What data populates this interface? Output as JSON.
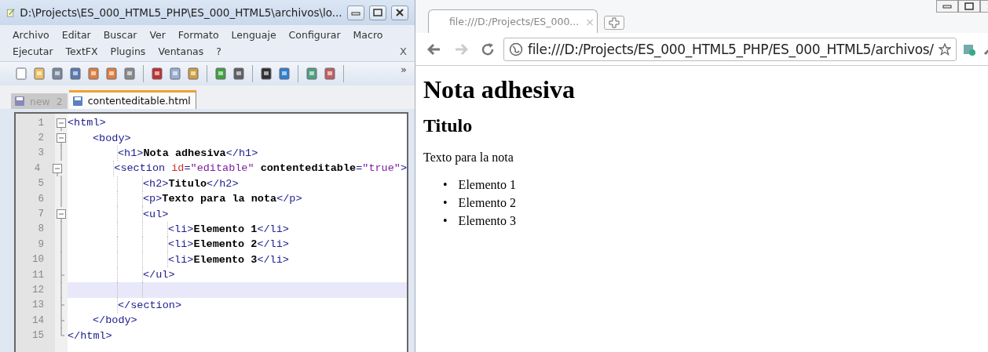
{
  "editor": {
    "title": "D:\\Projects\\ES_000_HTML5_PHP\\ES_000_HTML5\\archivos\\lo...",
    "menu_rows": [
      [
        "Archivo",
        "Editar",
        "Buscar",
        "Ver",
        "Formato",
        "Lenguaje",
        "Configurar",
        "Macro"
      ],
      [
        "Ejecutar",
        "TextFX",
        "Plugins",
        "Ventanas",
        "?"
      ]
    ],
    "menu_close": "X",
    "toolbar_more": "»",
    "tabs": [
      {
        "label": "new  2",
        "selected": false
      },
      {
        "label": "contenteditable.html",
        "selected": true
      }
    ],
    "lines": [
      {
        "number": "1",
        "kind": "fold-start",
        "current": false,
        "tokens": [
          {
            "kind": "tag",
            "text": "<html>"
          }
        ],
        "children": [
          {
            "number": "2",
            "kind": "fold-start",
            "current": false,
            "tokens": [
              {
                "kind": "tag",
                "text": "<body>"
              }
            ],
            "children": [
              {
                "number": "3",
                "kind": "fold-line",
                "current": false,
                "tokens": [
                  {
                    "kind": "tag",
                    "text": "<h1>"
                  },
                  {
                    "kind": "text",
                    "text": "Nota adhesiva"
                  },
                  {
                    "kind": "tag",
                    "text": "</h1>"
                  }
                ]
              },
              {
                "number": "4",
                "kind": "fold-start",
                "current": false,
                "tokens": [
                  {
                    "kind": "tag",
                    "text": "<section "
                  },
                  {
                    "kind": "attr",
                    "text": "id"
                  },
                  {
                    "kind": "tag",
                    "text": "="
                  },
                  {
                    "kind": "value",
                    "text": "\"editable\""
                  },
                  {
                    "kind": "text",
                    "text": " contenteditable"
                  },
                  {
                    "kind": "tag",
                    "text": "="
                  },
                  {
                    "kind": "value",
                    "text": "\"true\""
                  },
                  {
                    "kind": "tag",
                    "text": ">"
                  }
                ],
                "children": [
                  {
                    "number": "5",
                    "kind": "fold-line",
                    "current": false,
                    "tokens": [
                      {
                        "kind": "tag",
                        "text": "<h2>"
                      },
                      {
                        "kind": "text",
                        "text": "Titulo"
                      },
                      {
                        "kind": "tag",
                        "text": "</h2>"
                      }
                    ]
                  },
                  {
                    "number": "6",
                    "kind": "fold-line",
                    "current": false,
                    "tokens": [
                      {
                        "kind": "tag",
                        "text": "<p>"
                      },
                      {
                        "kind": "text",
                        "text": "Texto para la nota"
                      },
                      {
                        "kind": "tag",
                        "text": "</p>"
                      }
                    ]
                  },
                  {
                    "number": "7",
                    "kind": "fold-start",
                    "current": false,
                    "tokens": [
                      {
                        "kind": "tag",
                        "text": "<ul>"
                      }
                    ],
                    "children": [
                      {
                        "number": "8",
                        "kind": "fold-line",
                        "current": false,
                        "tokens": [
                          {
                            "kind": "tag",
                            "text": "<li>"
                          },
                          {
                            "kind": "text",
                            "text": "Elemento 1"
                          },
                          {
                            "kind": "tag",
                            "text": "</li>"
                          }
                        ]
                      },
                      {
                        "number": "9",
                        "kind": "fold-line",
                        "current": false,
                        "tokens": [
                          {
                            "kind": "tag",
                            "text": "<li>"
                          },
                          {
                            "kind": "text",
                            "text": "Elemento 2"
                          },
                          {
                            "kind": "tag",
                            "text": "</li>"
                          }
                        ]
                      },
                      {
                        "number": "10",
                        "kind": "fold-line",
                        "current": false,
                        "tokens": [
                          {
                            "kind": "tag",
                            "text": "<li>"
                          },
                          {
                            "kind": "text",
                            "text": "Elemento 3"
                          },
                          {
                            "kind": "tag",
                            "text": "</li>"
                          }
                        ]
                      }
                    ]
                  },
                  {
                    "number": "11",
                    "kind": "fold-end",
                    "current": false,
                    "tokens": [
                      {
                        "kind": "tag",
                        "text": "</ul>"
                      }
                    ]
                  },
                  {
                    "number": "12",
                    "kind": "fold-line",
                    "current": true
                  }
                ]
              },
              {
                "number": "13",
                "kind": "fold-end",
                "current": false,
                "tokens": [
                  {
                    "kind": "tag",
                    "text": "</section>"
                  }
                ]
              }
            ]
          },
          {
            "number": "14",
            "kind": "fold-end",
            "current": false,
            "tokens": [
              {
                "kind": "tag",
                "text": "</body>"
              }
            ]
          }
        ]
      },
      {
        "number": "15",
        "kind": "fold-last",
        "current": false,
        "tokens": [
          {
            "kind": "tag",
            "text": "</html>"
          }
        ]
      }
    ]
  },
  "browser": {
    "tab_title": "file:///D:/Projects/ES_000...",
    "tab_close": "×",
    "address": "file:///D:/Projects/ES_000_HTML5_PHP/ES_000_HTML5/archivos/",
    "page": {
      "heading": "Nota adhesiva",
      "subheading": "Titulo",
      "paragraph": "Texto para la nota",
      "items": [
        {
          "marker": "•",
          "text": "Elemento 1"
        },
        {
          "marker": "•",
          "text": "Elemento 2"
        },
        {
          "marker": "•",
          "text": "Elemento 3"
        }
      ]
    }
  }
}
